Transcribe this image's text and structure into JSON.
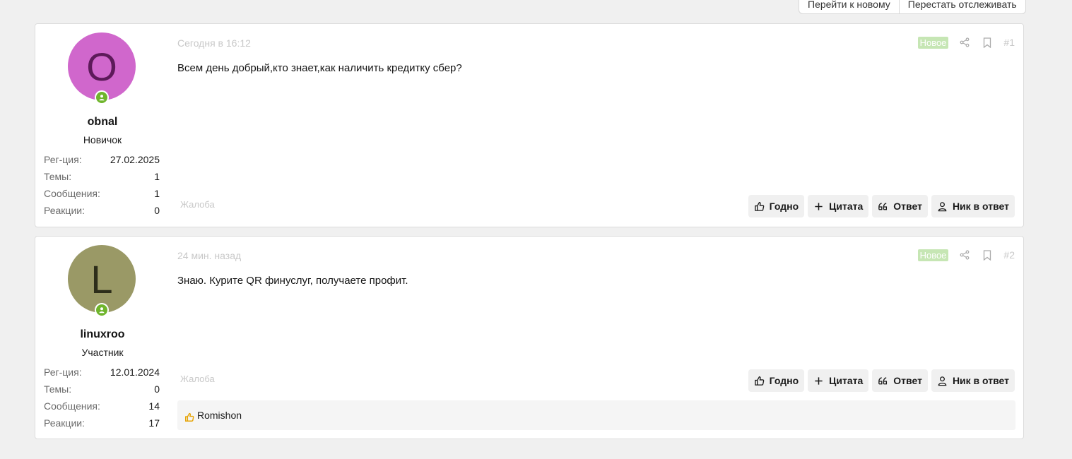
{
  "top_actions": [
    "Перейти к новому",
    "Перестать отслеживать"
  ],
  "colors": {
    "new_badge": "#c6e6b4",
    "online": "#6fb52c",
    "reaction_icon": "#e6a200"
  },
  "posts": [
    {
      "avatar_letter": "O",
      "avatar_bg": "#d067cc",
      "avatar_fg": "#5d1a5a",
      "username": "obnal",
      "user_title": "Новичок",
      "stats": [
        {
          "label": "Рег-ция:",
          "value": "27.02.2025"
        },
        {
          "label": "Темы:",
          "value": "1"
        },
        {
          "label": "Сообщения:",
          "value": "1"
        },
        {
          "label": "Реакции:",
          "value": "0"
        }
      ],
      "date": "Сегодня в 16:12",
      "badge": "Новое",
      "number": "#1",
      "message": "Всем день добрый,кто знает,как наличить кредитку сбер?",
      "report": "Жалоба"
    },
    {
      "avatar_letter": "L",
      "avatar_bg": "#9a9966",
      "avatar_fg": "#2d2d1a",
      "username": "linuxroo",
      "user_title": "Участник",
      "stats": [
        {
          "label": "Рег-ция:",
          "value": "12.01.2024"
        },
        {
          "label": "Темы:",
          "value": "0"
        },
        {
          "label": "Сообщения:",
          "value": "14"
        },
        {
          "label": "Реакции:",
          "value": "17"
        }
      ],
      "date": "24 мин. назад",
      "badge": "Новое",
      "number": "#2",
      "message": "Знаю. Курите QR финуслуг, получаете профит.",
      "report": "Жалоба",
      "reaction_user": "Romishon"
    }
  ],
  "action_buttons": {
    "like": "Годно",
    "quote": "Цитата",
    "reply": "Ответ",
    "mention": "Ник в ответ"
  },
  "icons": [
    "share-icon",
    "bookmark-icon",
    "thumbs-up-icon",
    "plus-icon",
    "quote-icon",
    "user-icon",
    "online-user-icon"
  ]
}
